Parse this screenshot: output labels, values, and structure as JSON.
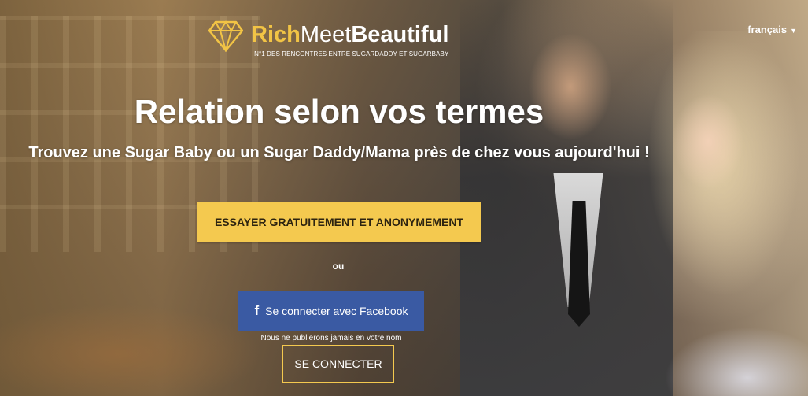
{
  "language": {
    "label": "français",
    "caret_icon": "caret-down-icon"
  },
  "logo": {
    "icon": "diamond-icon",
    "brand_rich": "Rich",
    "brand_meet": "Meet",
    "brand_beautiful": "Beautiful",
    "tagline": "N°1 DES RENCONTRES ENTRE SUGARDADDY ET SUGARBABY"
  },
  "hero": {
    "title": "Relation selon vos termes",
    "subtitle": "Trouvez une Sugar Baby ou un Sugar Daddy/Mama près de chez vous aujourd'hui !"
  },
  "actions": {
    "cta_label": "ESSAYER GRATUITEMENT ET ANONYMEMENT",
    "or_label": "ou",
    "facebook_icon": "facebook-f-icon",
    "facebook_label": "Se connecter avec Facebook",
    "facebook_note": "Nous ne publierons jamais en votre nom",
    "login_label": "SE CONNECTER"
  },
  "colors": {
    "accent": "#f4c94f",
    "facebook": "#3a5aa3"
  }
}
